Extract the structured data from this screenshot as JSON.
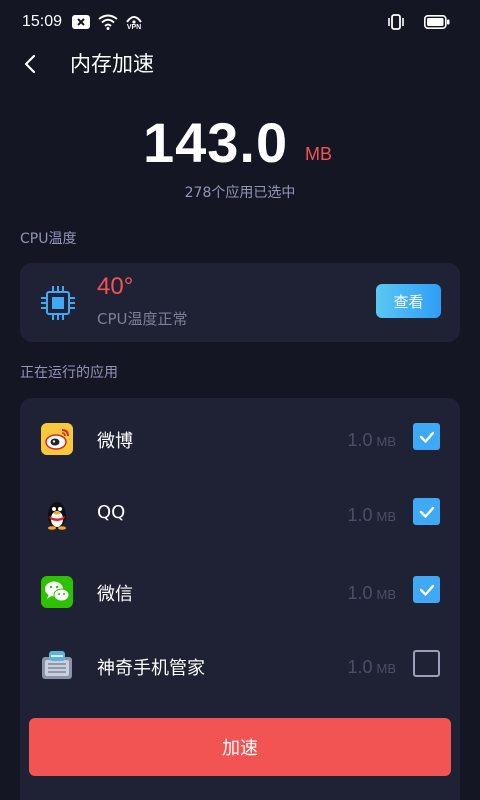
{
  "status_bar": {
    "time": "15:09",
    "icons": [
      "notification-x-icon",
      "wifi-icon",
      "vpn-icon",
      "vibrate-icon",
      "battery-icon"
    ],
    "vpn_label": "VPN"
  },
  "header": {
    "title": "内存加速",
    "back_icon": "chevron-left-icon"
  },
  "memory": {
    "value": "143.0",
    "unit": "MB",
    "selected_text": "278个应用已选中"
  },
  "cpu": {
    "section_label": "CPU温度",
    "temperature": "40°",
    "status": "CPU温度正常",
    "view_button_label": "查看",
    "icon": "cpu-chip-icon"
  },
  "apps": {
    "section_label": "正在运行的应用",
    "items": [
      {
        "name": "微博",
        "size": "1.0",
        "unit": "MB",
        "checked": true,
        "icon": "weibo-icon"
      },
      {
        "name": "QQ",
        "size": "1.0",
        "unit": "MB",
        "checked": true,
        "icon": "qq-penguin-icon"
      },
      {
        "name": "微信",
        "size": "1.0",
        "unit": "MB",
        "checked": true,
        "icon": "wechat-icon"
      },
      {
        "name": "神奇手机管家",
        "size": "1.0",
        "unit": "MB",
        "checked": false,
        "icon": "phone-manager-icon"
      }
    ]
  },
  "accelerate_button_label": "加速",
  "colors": {
    "background": "#141624",
    "card": "#1f2235",
    "accent_red": "#f25454",
    "accent_blue": "#3fa9f5",
    "muted_text": "#9096b4"
  }
}
